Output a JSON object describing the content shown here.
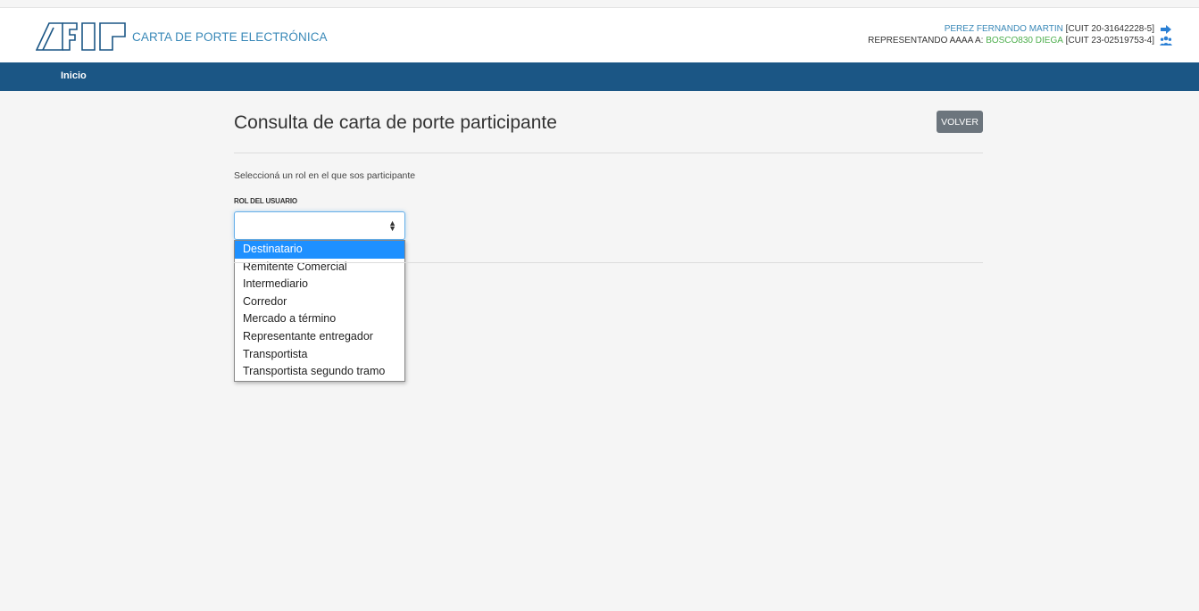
{
  "header": {
    "app_title": "CARTA DE PORTE ELECTRÓNICA",
    "user_name": "PEREZ FERNANDO MARTIN",
    "user_cuit": "[CUIT 20-31642228-5]",
    "represent_prefix": "REPRESENTANDO AAAA A:",
    "represented_name": "BOSCO830 DIEGA",
    "represented_cuit": "[CUIT 23-02519753-4]",
    "logout_icon": "logout-icon",
    "users_icon": "users-icon"
  },
  "nav": {
    "home": "Inicio"
  },
  "main": {
    "title": "Consulta de carta de porte participante",
    "back_label": "VOLVER",
    "instructions": "Seleccioná un rol en el que sos participante",
    "role_label": "ROL DEL USUARIO",
    "role_options": [
      "Destinatario",
      "Remitente Comercial",
      "Intermediario",
      "Corredor",
      "Mercado a término",
      "Representante entregador",
      "Transportista",
      "Transportista segundo tramo"
    ],
    "highlighted_option": "Destinatario"
  },
  "colors": {
    "brand_blue": "#3a89b8",
    "nav_bg": "#1b5685",
    "highlight": "#1e90ff",
    "represented_green": "#4cae4c"
  }
}
